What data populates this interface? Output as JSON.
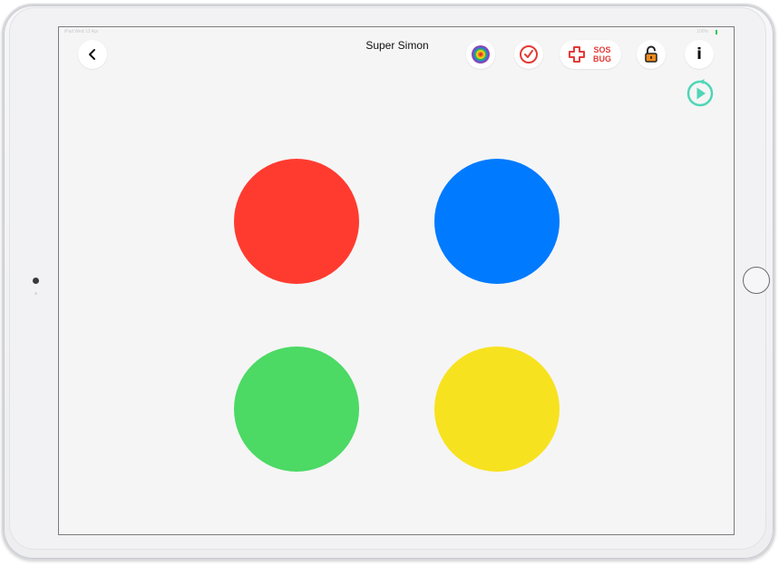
{
  "app": {
    "title": "Super Simon"
  },
  "status_bar": {
    "left_text": "iPad  Wed 13 Apr",
    "right_text": "100%"
  },
  "toolbar": {
    "back_icon": "chevron-left-icon",
    "rainbow_icon": "rainbow-circle-icon",
    "timer_icon": "clock-check-icon",
    "sos_line1": "SOS",
    "sos_line2": "BUG",
    "sos_icon": "medical-cross-icon",
    "lock_icon": "unlocked-padlock-icon",
    "info_label": "i",
    "play_icon": "replay-play-icon"
  },
  "game": {
    "pads": [
      {
        "name": "red",
        "color": "#ff3b30"
      },
      {
        "name": "blue",
        "color": "#007aff"
      },
      {
        "name": "green",
        "color": "#4cd964"
      },
      {
        "name": "yellow",
        "color": "#f7e21f"
      }
    ]
  },
  "colors": {
    "screen_background": "#f5f5f5",
    "accent_red": "#e33a36",
    "play_accent": "#4fd6b8"
  }
}
